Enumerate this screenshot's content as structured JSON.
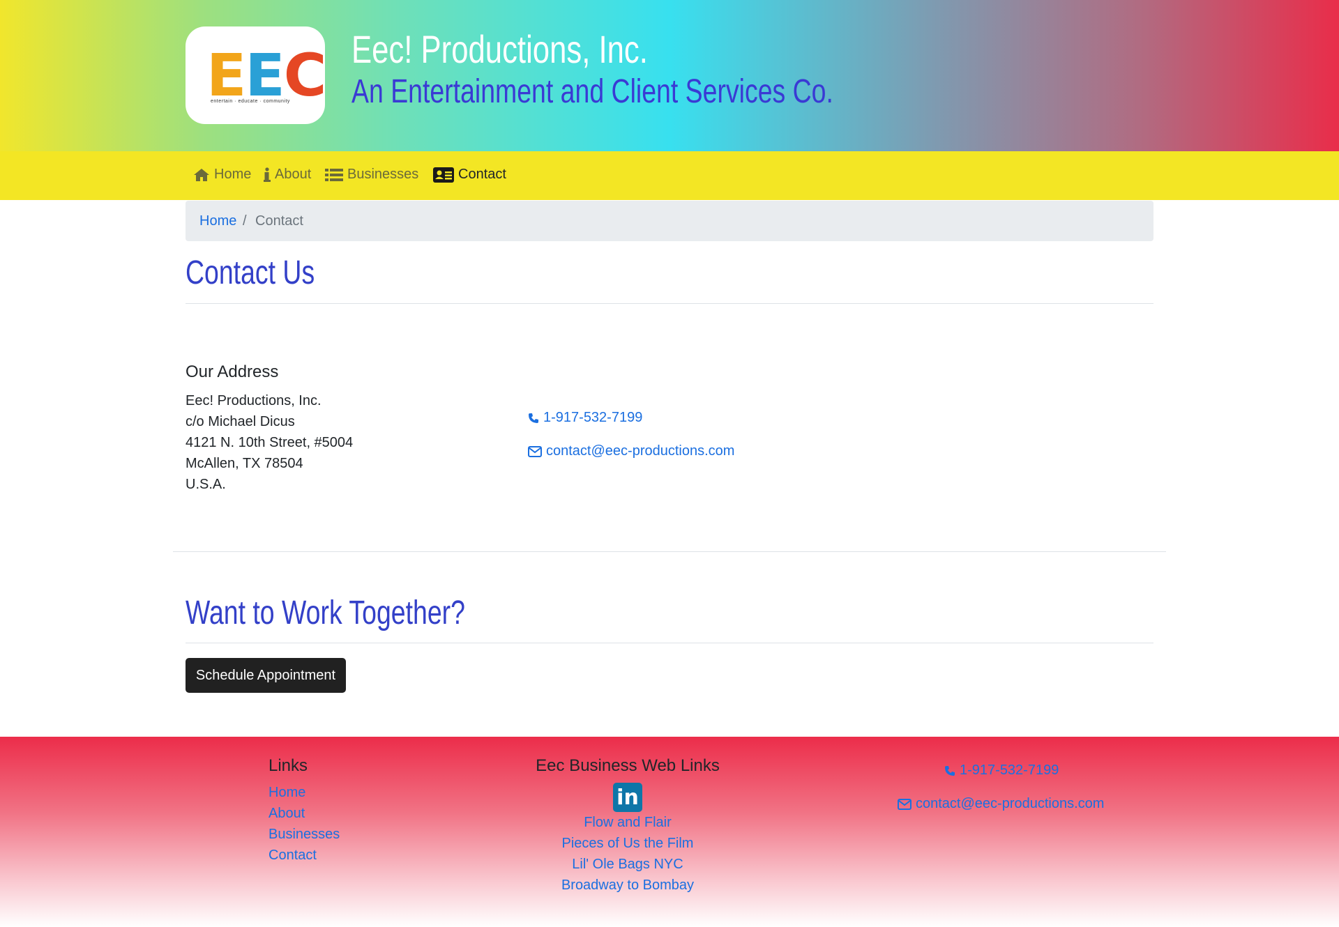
{
  "header": {
    "logo_letters": [
      "E",
      "E",
      "C",
      "!"
    ],
    "logo_tagline": "entertain · educate · community",
    "title": "Eec! Productions, Inc.",
    "subtitle": "An Entertainment and Client Services Co."
  },
  "nav": {
    "items": [
      {
        "label": "Home",
        "icon": "home-icon"
      },
      {
        "label": "About",
        "icon": "info-icon"
      },
      {
        "label": "Businesses",
        "icon": "list-icon"
      },
      {
        "label": "Contact",
        "icon": "id-card-icon",
        "active": true
      }
    ]
  },
  "breadcrumb": {
    "home": "Home",
    "separator": "/",
    "current": "Contact"
  },
  "contact": {
    "title": "Contact Us",
    "address_heading": "Our Address",
    "address_lines": [
      "Eec! Productions, Inc.",
      "c/o Michael Dicus",
      "4121 N. 10th Street, #5004",
      "McAllen, TX 78504",
      "U.S.A."
    ],
    "phone": "1-917-532-7199",
    "email": "contact@eec-productions.com"
  },
  "work": {
    "title": "Want to Work Together?",
    "button": "Schedule Appointment"
  },
  "footer": {
    "links_heading": "Links",
    "links": [
      "Home",
      "About",
      "Businesses",
      "Contact"
    ],
    "business_heading": "Eec Business Web Links",
    "linkedin_icon": "linkedin-icon",
    "business_links": [
      "Flow and Flair",
      "Pieces of Us the Film",
      "Lil' Ole Bags NYC",
      "Broadway to Bombay"
    ],
    "phone": "1-917-532-7199",
    "email": "contact@eec-productions.com"
  },
  "colors": {
    "nav_bg": "#f3e624",
    "heading_blue": "#3340c8",
    "link_blue": "#1b6fe0",
    "footer_red": "#ec2d4a"
  }
}
